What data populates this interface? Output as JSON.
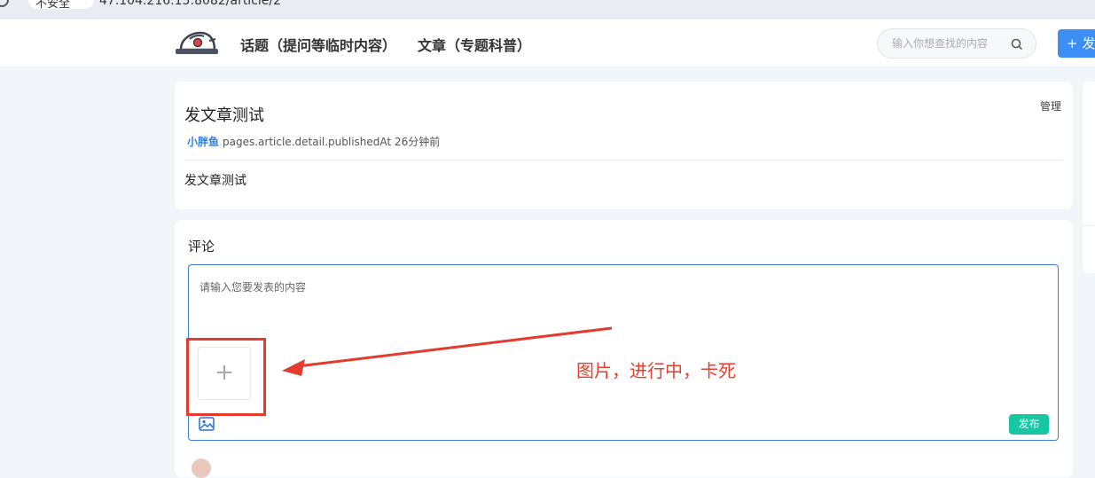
{
  "browser": {
    "security_label": "不安全",
    "url": "47.104.216.15:8082/article/2"
  },
  "header": {
    "nav": [
      {
        "label": "话题（提问等临时内容）"
      },
      {
        "label": "文章（专题科普）"
      }
    ],
    "search_placeholder": "输入你想查找的内容",
    "publish_button": "+ 发"
  },
  "article": {
    "title": "发文章测试",
    "manage_label": "管理",
    "author": "小胖鱼",
    "published_meta": "pages.article.detail.publishedAt 26分钟前",
    "body": "发文章测试"
  },
  "comments": {
    "label": "评论",
    "input_placeholder": "请输入您要发表的内容",
    "upload_plus": "+",
    "submit_label": "发布"
  },
  "annotation": {
    "text": "图片，进行中，卡死",
    "color": "#e53b2f"
  },
  "colors": {
    "accent_blue": "#3d8ef4",
    "submit_green": "#17c7a3",
    "author_blue": "#2d7fe0"
  }
}
